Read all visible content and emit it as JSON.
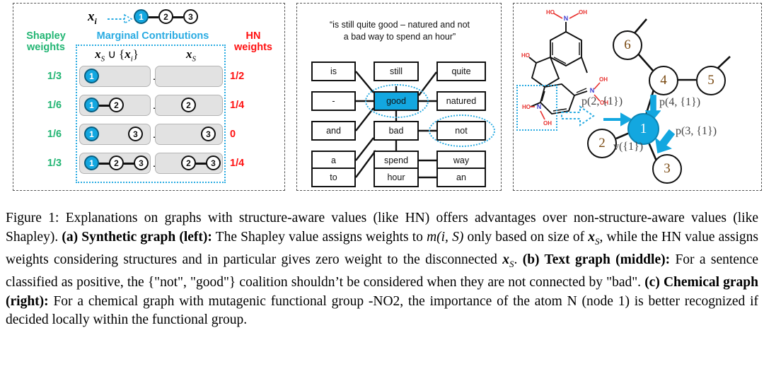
{
  "figure": {
    "panel_a": {
      "top_label_xi": "x_i",
      "chain_nodes": [
        "1",
        "2",
        "3"
      ],
      "left_header": "Shapley\nweights",
      "left_header_line1": "Shapley",
      "left_header_line2": "weights",
      "center_header": "Marginal Contributions",
      "right_header_line1": "HN",
      "right_header_line2": "weights",
      "col_header_left": "x_S ∪ {x_i}",
      "col_header_right": "x_S",
      "rows": [
        {
          "shapley_weight": "1/3",
          "hn_weight": "1/2",
          "with_i": {
            "nodes": [
              "1"
            ],
            "edges": []
          },
          "without_i": {
            "nodes": [],
            "edges": []
          }
        },
        {
          "shapley_weight": "1/6",
          "hn_weight": "1/4",
          "with_i": {
            "nodes": [
              "1",
              "2"
            ],
            "edges": [
              [
                "1",
                "2"
              ]
            ]
          },
          "without_i": {
            "nodes": [
              "2"
            ],
            "edges": []
          }
        },
        {
          "shapley_weight": "1/6",
          "hn_weight": "0",
          "with_i": {
            "nodes": [
              "1",
              "3"
            ],
            "edges": []
          },
          "without_i": {
            "nodes": [
              "3"
            ],
            "edges": []
          }
        },
        {
          "shapley_weight": "1/3",
          "hn_weight": "1/4",
          "with_i": {
            "nodes": [
              "1",
              "2",
              "3"
            ],
            "edges": [
              [
                "1",
                "2"
              ],
              [
                "2",
                "3"
              ]
            ]
          },
          "without_i": {
            "nodes": [
              "2",
              "3"
            ],
            "edges": [
              [
                "2",
                "3"
              ]
            ]
          }
        }
      ],
      "minus_symbol": "—"
    },
    "panel_b": {
      "sentence_line1": "“is still quite good – natured and not",
      "sentence_line2": "a bad way to spend an hour”",
      "words_col1": [
        "is",
        "-",
        "and",
        "a",
        "to"
      ],
      "words_col2": [
        "still",
        "good",
        "bad",
        "spend",
        "hour"
      ],
      "words_col3": [
        "quite",
        "natured",
        "not",
        "way",
        "an"
      ],
      "highlighted_word": "good",
      "circled_words": [
        "good",
        "not"
      ]
    },
    "panel_c": {
      "molecule": {
        "atom_labels": [
          "HO",
          "OH",
          "N",
          "OH",
          "HO",
          "OH",
          "N",
          "HO",
          "N",
          "OH"
        ],
        "nitrogen_color": "#3b3bcf",
        "oxygen_color": "#e8312e"
      },
      "graph_nodes": [
        "1",
        "2",
        "3",
        "4",
        "5",
        "6"
      ],
      "highlighted_node": "1",
      "edges": [
        [
          "2",
          "1"
        ],
        [
          "3",
          "1"
        ],
        [
          "1",
          "4"
        ],
        [
          "4",
          "5"
        ],
        [
          "4",
          "6"
        ]
      ],
      "annotations": [
        "p(2, {1})",
        "p(4, {1})",
        "p(3, {1})",
        "v({1})"
      ],
      "arrow_labels": {
        "from2": "p(2, {1})",
        "from4": "p(4, {1})",
        "from3": "p(3, {1})",
        "value": "v({1})"
      }
    },
    "colors": {
      "highlight_blue": "#13a7e0",
      "shapley_green": "#22b573",
      "hn_red": "#ff1111",
      "marginal_blue": "#29abe2",
      "oxygen_red": "#e8312e",
      "nitrogen_blue": "#3b3bcf"
    }
  },
  "caption": {
    "label": "Figure 1:",
    "seg1": " Explanations on graphs with structure-aware values (like HN) offers advantages over non-structure-aware values (like Shapley). ",
    "b_a": "(a) Synthetic graph (left):",
    "seg2": " The Shapley value assigns weights to ",
    "math1": "m(i, S)",
    "seg3": " only based on size of ",
    "math2": "x",
    "math2sub": "S",
    "seg4": ", while the HN value assigns weights considering structures and in particular gives zero weight to the disconnected ",
    "math3": "x",
    "math3sub": "S",
    "seg5": ". ",
    "b_b": "(b) Text graph (middle):",
    "seg6": " For a sentence classified as positive, the {\"not\", \"good\"} coalition shouldn’t be considered when they are not connected by \"bad\". ",
    "b_c": "(c) Chemical graph (right):",
    "seg7": " For a chemical graph with mutagenic functional group -NO2, the importance of the atom N (node 1) is better recognized if decided locally within the functional group."
  }
}
